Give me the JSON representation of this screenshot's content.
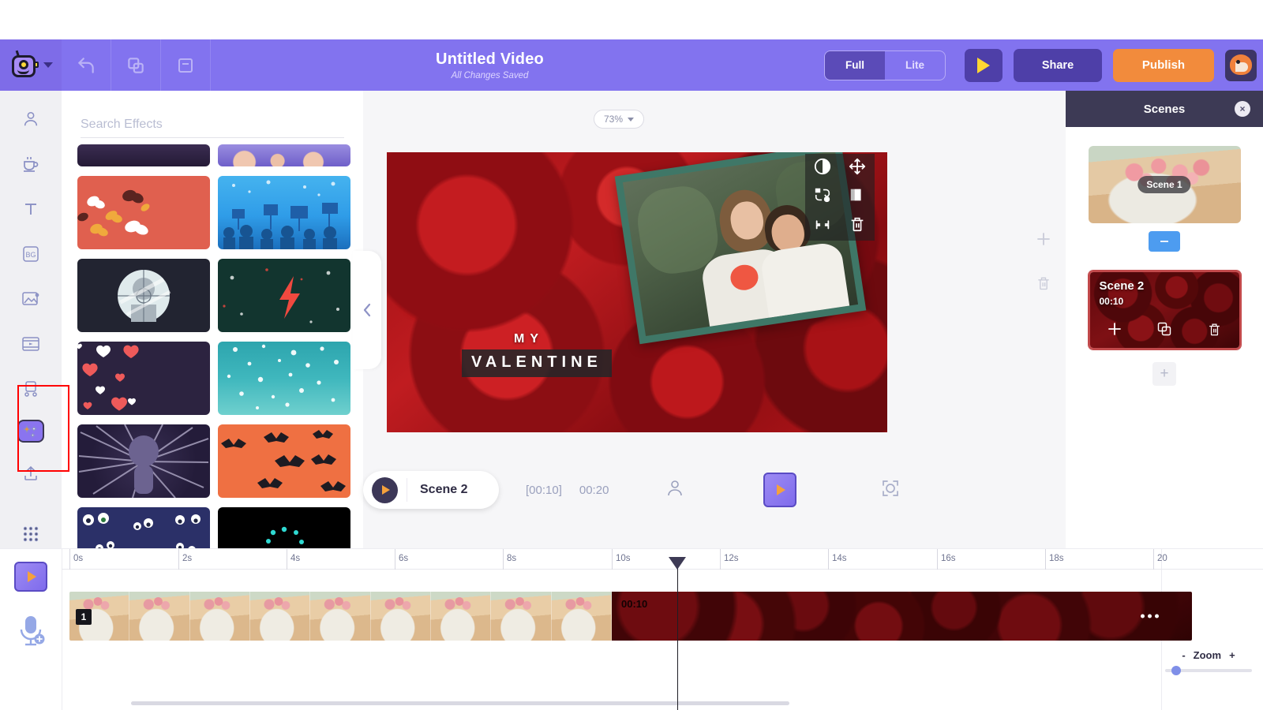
{
  "topbar": {
    "logo_name": "app-logo",
    "undo_label": "Undo",
    "copy_label": "Duplicate",
    "note_label": "Notes",
    "title": "Untitled Video",
    "subtitle": "All Changes Saved",
    "mode_full": "Full",
    "mode_lite": "Lite",
    "preview_label": "Preview",
    "share_label": "Share",
    "publish_label": "Publish",
    "avatar_label": "Account"
  },
  "sidebar": {
    "items": [
      {
        "name": "avatar-character",
        "label": "Character"
      },
      {
        "name": "coffee",
        "label": "Props"
      },
      {
        "name": "text",
        "label": "Text"
      },
      {
        "name": "background",
        "label": "BG"
      },
      {
        "name": "image",
        "label": "Image"
      },
      {
        "name": "video",
        "label": "Video"
      },
      {
        "name": "shapes",
        "label": "Shapes"
      },
      {
        "name": "effects",
        "label": "Effects"
      },
      {
        "name": "upload",
        "label": "Upload"
      },
      {
        "name": "more",
        "label": "More"
      }
    ]
  },
  "effects_panel": {
    "search_placeholder": "Search Effects",
    "collapse_label": "Collapse panel",
    "tiles": [
      {
        "name": "effect-dark-strip",
        "color": "#2a1f3d"
      },
      {
        "name": "effect-crowd-hands",
        "color": "#8b7fd4"
      },
      {
        "name": "effect-butterflies",
        "color": "#e0604f"
      },
      {
        "name": "effect-protest-crowd",
        "color": "#2f9ce8"
      },
      {
        "name": "effect-target-scope",
        "color": "#222431"
      },
      {
        "name": "effect-lightning-bolt",
        "color": "#12352f"
      },
      {
        "name": "effect-hearts",
        "color": "#2c2340"
      },
      {
        "name": "effect-snow-teal",
        "color": "#3fb7bd"
      },
      {
        "name": "effect-speed-lines",
        "color": "#2d2545"
      },
      {
        "name": "effect-bats",
        "color": "#ef7042"
      },
      {
        "name": "effect-googly-eyes",
        "color": "#2b3068"
      },
      {
        "name": "effect-loading-dots",
        "color": "#000000"
      }
    ]
  },
  "canvas": {
    "zoom_level": "73%",
    "caption_line1": "MY",
    "caption_line2": "VALENTINE",
    "toolbar_icons": [
      {
        "name": "opacity-icon",
        "label": "Opacity"
      },
      {
        "name": "move-icon",
        "label": "Move"
      },
      {
        "name": "replace-icon",
        "label": "Replace"
      },
      {
        "name": "flip-icon",
        "label": "Flip"
      },
      {
        "name": "shrink-icon",
        "label": "Shrink"
      },
      {
        "name": "delete-icon",
        "label": "Delete"
      }
    ],
    "side_add_label": "Add",
    "side_delete_label": "Delete"
  },
  "scenebar": {
    "scene_name": "Scene 2",
    "time_current": "[00:10]",
    "time_total": "00:20",
    "character_icon": "character-icon",
    "transition_icon": "transition-icon",
    "focus_icon": "focus-icon"
  },
  "scenes_panel": {
    "title": "Scenes",
    "close_label": "×",
    "scene1": {
      "label": "Scene 1"
    },
    "scene2": {
      "title": "Scene 2",
      "time": "00:10"
    },
    "add_scene_label": "+",
    "scene2_actions": [
      {
        "name": "add-scene-icon",
        "label": "+"
      },
      {
        "name": "duplicate-scene-icon",
        "label": "Duplicate"
      },
      {
        "name": "delete-scene-icon",
        "label": "Delete"
      }
    ]
  },
  "timeline": {
    "ticks": [
      "0s",
      "2s",
      "4s",
      "6s",
      "8s",
      "10s",
      "12s",
      "14s",
      "16s",
      "18s",
      "20"
    ],
    "clip1_number": "1",
    "clip2_time": "00:10",
    "clip2_menu": "•••",
    "zoom_label": "Zoom",
    "zoom_minus": "-",
    "zoom_plus": "+",
    "video_track_icon": "video-track-icon",
    "audio_track_icon": "microphone-add-icon"
  }
}
